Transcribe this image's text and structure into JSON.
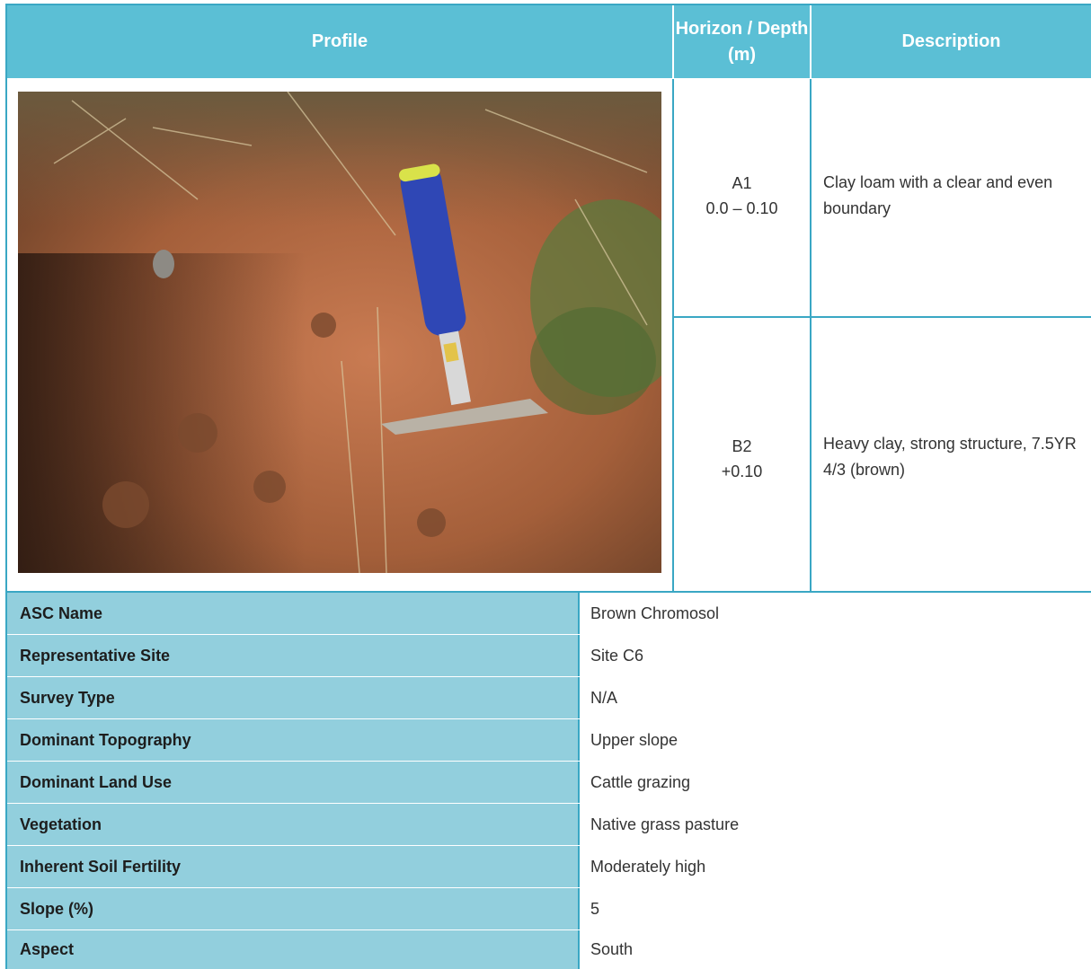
{
  "headers": {
    "profile": "Profile",
    "horizon": "Horizon / Depth (m)",
    "description": "Description"
  },
  "horizons": [
    {
      "code": "A1",
      "depth": "0.0 – 0.10",
      "description": "Clay loam with a clear and even boundary"
    },
    {
      "code": "B2",
      "depth": "+0.10",
      "description": "Heavy clay, strong structure, 7.5YR 4/3 (brown)"
    }
  ],
  "properties": [
    {
      "label": "ASC Name",
      "value": "Brown Chromosol"
    },
    {
      "label": "Representative Site",
      "value": "Site C6"
    },
    {
      "label": "Survey Type",
      "value": "N/A"
    },
    {
      "label": "Dominant Topography",
      "value": "Upper slope"
    },
    {
      "label": "Dominant Land Use",
      "value": "Cattle grazing"
    },
    {
      "label": "Vegetation",
      "value": "Native grass pasture"
    },
    {
      "label": "Inherent Soil Fertility",
      "value": "Moderately high"
    },
    {
      "label": "Slope (%)",
      "value": "5"
    },
    {
      "label": "Aspect",
      "value": "South"
    }
  ],
  "colors": {
    "header_bg": "#5bbfd5",
    "label_bg": "#92cfdd",
    "border": "#3aa7c4"
  }
}
